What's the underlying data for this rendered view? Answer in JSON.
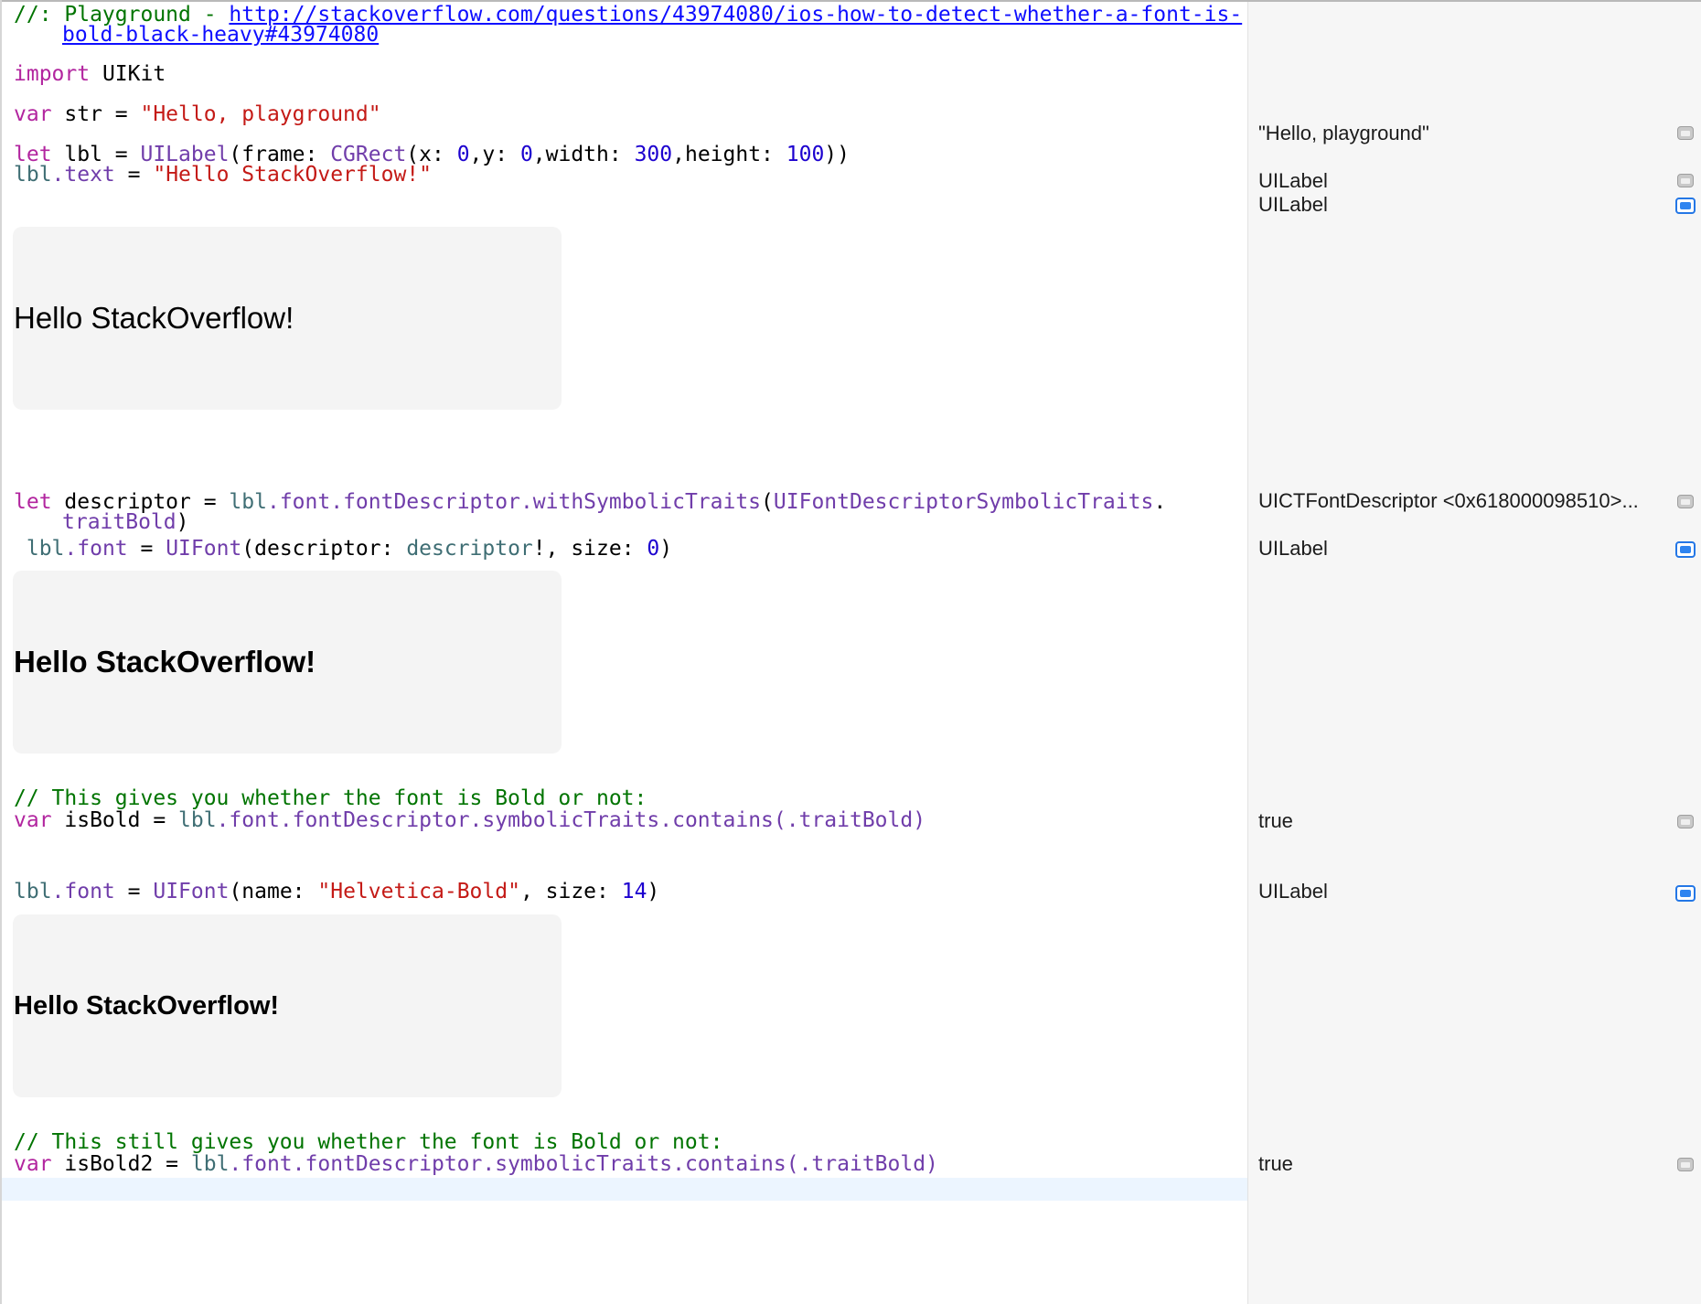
{
  "code": {
    "line1_prefix": "//: Playground - ",
    "line1_link_a": "http://stackoverflow.com/questions/43974080/ios-how-to-detect-whether-a-font-is-",
    "line1_link_b": "bold-black-heavy#43974080",
    "import_kw": "import",
    "import_mod": " UIKit",
    "var_kw": "var",
    "str_decl": " str = ",
    "str_value": "\"Hello, playground\"",
    "let_kw": "let",
    "lbl_decl": " lbl = ",
    "uilabel": "UILabel",
    "frame_arg": "(frame: ",
    "cgrect": "CGRect",
    "x_arg": "(x: ",
    "x_val": "0",
    "y_arg": ",y: ",
    "y_val": "0",
    "w_arg": ",width: ",
    "w_val": "300",
    "h_arg": ",height: ",
    "h_val": "100",
    "close2": "))",
    "lbl": "lbl",
    "dot_text": ".text",
    "assign": " = ",
    "text_value": "\"Hello StackOverflow!\"",
    "descriptor_decl": " descriptor = ",
    "dot_font": ".font",
    "dot_fontDescriptor": ".fontDescriptor",
    "dot_withSymbolicTraits": ".withSymbolicTraits",
    "open_paren": "(",
    "traits_type": "UIFontDescriptorSymbolicTraits",
    "dot": ".",
    "trait_bold": "traitBold",
    "close_paren": ")",
    "indent1": " ",
    "uifont": "UIFont",
    "descriptor_arg": "(descriptor: ",
    "descriptor_var": "descriptor",
    "size_arg": "!, size: ",
    "size_zero": "0",
    "comment1": "// This gives you whether the font is Bold or not:",
    "isbold_decl": " isBold = ",
    "dot_symbolicTraits": ".symbolicTraits",
    "dot_contains": ".contains",
    "dot_traitBold_arg": "(.traitBold)",
    "name_arg": "(name: ",
    "font_name": "\"Helvetica-Bold\"",
    "size_arg2": ", size: ",
    "size_14": "14",
    "comment2": "// This still gives you whether the font is Bold or not:",
    "isbold2_decl": " isBold2 = "
  },
  "previews": [
    {
      "text": "Hello StackOverflow!"
    },
    {
      "text": "Hello StackOverflow!"
    },
    {
      "text": "Hello StackOverflow!"
    }
  ],
  "results": {
    "str": "\"Hello, playground\"",
    "lbl": "UILabel",
    "lbl_text": "UILabel",
    "descriptor": "UICTFontDescriptor <0x618000098510>...",
    "lbl_font": "UILabel",
    "isbold": "true",
    "lbl_font2": "UILabel",
    "isbold2": "true"
  },
  "icons": {
    "gray": "quick-look-icon",
    "blue": "show-result-icon"
  },
  "colors": {
    "keyword": "#b2259f",
    "string": "#c41a16",
    "comment": "#007400",
    "number": "#1c00cf",
    "type": "#703daa",
    "property": "#3f6e74",
    "link": "#0e0eff",
    "active_line": "#ecf5ff",
    "results_bg": "#f6f6f6",
    "toggle_blue": "#2e84f0"
  }
}
